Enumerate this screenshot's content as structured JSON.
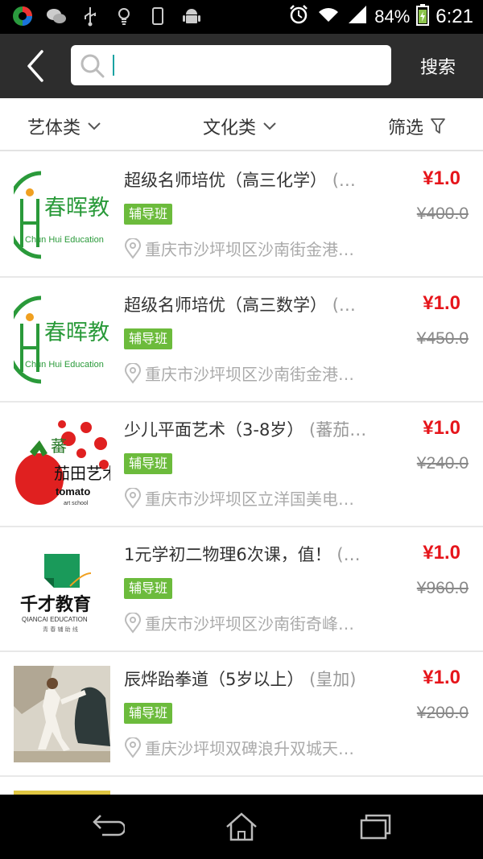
{
  "status_bar": {
    "battery": "84%",
    "time": "6:21",
    "icons": [
      "app-circle-icon",
      "wechat-icon",
      "usb-icon",
      "bulb-icon",
      "phone-icon",
      "android-icon",
      "alarm-icon",
      "wifi-icon",
      "signal-icon",
      "battery-icon"
    ]
  },
  "header": {
    "back_icon": "chevron-left-icon",
    "search_placeholder": "",
    "search_value": "",
    "search_button": "搜索"
  },
  "filters": [
    {
      "label": "艺体类",
      "icon": "chevron-down-icon"
    },
    {
      "label": "文化类",
      "icon": "chevron-down-icon"
    },
    {
      "label": "筛选",
      "icon": "filter-funnel-icon"
    }
  ],
  "items": [
    {
      "title": "超级名师培优（高三化学）",
      "extra": "(…",
      "tag": "辅导班",
      "address": "重庆市沙坪坝区沙南街金港…",
      "price": "¥1.0",
      "original_price": "¥400.0",
      "logo": "春晖教育 Chun Hui Education"
    },
    {
      "title": "超级名师培优（高三数学）",
      "extra": "(…",
      "tag": "辅导班",
      "address": "重庆市沙坪坝区沙南街金港…",
      "price": "¥1.0",
      "original_price": "¥450.0",
      "logo": "春晖教育 Chun Hui Education"
    },
    {
      "title": "少儿平面艺术（3-8岁）",
      "extra": "(蕃茄…",
      "tag": "辅导班",
      "address": "重庆市沙坪坝区立洋国美电…",
      "price": "¥1.0",
      "original_price": "¥240.0",
      "logo": "蕃茄田艺术 tomato art school"
    },
    {
      "title": "1元学初二物理6次课，值！",
      "extra": "(…",
      "tag": "辅导班",
      "address": "重庆市沙坪坝区沙南街奇峰…",
      "price": "¥1.0",
      "original_price": "¥960.0",
      "logo": "千才教育 QIANCAI EDUCATION 青春辅助线"
    },
    {
      "title": "辰烨跆拳道（5岁以上）",
      "extra": "(皇加)",
      "tag": "辅导班",
      "address": "重庆沙坪坝双碑浪升双城天…",
      "price": "¥1.0",
      "original_price": "¥200.0",
      "logo": "taekwondo-photo"
    }
  ],
  "nav_bar": {
    "icons": [
      "back-arrow-icon",
      "home-icon",
      "recent-apps-icon"
    ]
  },
  "colors": {
    "header_bg": "#2d2d2d",
    "tag_green": "#6cbb3c",
    "price_red": "#e6151b",
    "logo_green": "#2a9a3a"
  }
}
